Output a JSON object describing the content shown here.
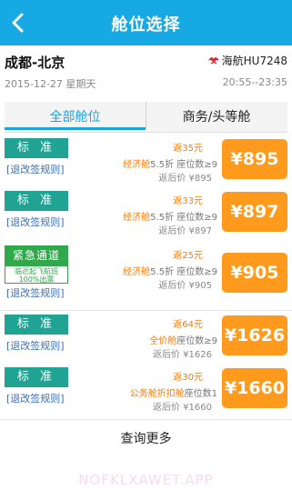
{
  "header": {
    "title": "舱位选择",
    "back_icon": "back-arrow-icon"
  },
  "route": {
    "name": "成都-北京",
    "airline": "海航HU7248",
    "airline_icon": "hainan-airlines-logo-icon",
    "date": "2015-12-27 星期天",
    "time": "20:55--23:35"
  },
  "tabs": [
    {
      "label": "全部舱位",
      "active": true
    },
    {
      "label": "商务/头等舱",
      "active": false
    }
  ],
  "fares": [
    {
      "badge": "标 准",
      "rules": "[退改签规则]",
      "discount": "返35元",
      "cabin": "经济舱",
      "cabin_info": "5.5折 座位数≥9",
      "after": "返后价 ¥895",
      "price": "¥895"
    },
    {
      "badge": "标 准",
      "rules": "[退改签规则]",
      "discount": "返33元",
      "cabin": "经济舱",
      "cabin_info": "5.5折 座位数≥9",
      "after": "返后价 ¥897",
      "price": "¥897"
    },
    {
      "badge": "紧急通道",
      "badge_sub": "临近起飞航班 100%出票",
      "rules": "[退改签规则]",
      "discount": "返25元",
      "cabin": "经济舱",
      "cabin_info": "5.5折 座位数≥9",
      "after": "返后价 ¥905",
      "price": "¥905"
    },
    {
      "badge": "标 准",
      "rules": "[退改签规则]",
      "discount": "返64元",
      "cabin": "全价舱",
      "cabin_info": "座位数≥9",
      "after": "返后价 ¥1626",
      "price": "¥1626"
    },
    {
      "badge": "标 准",
      "rules": "[退改签规则]",
      "discount": "返30元",
      "cabin": "公务舱折扣舱",
      "cabin_info": "座位数1",
      "after": "返后价 ¥1660",
      "price": "¥1660"
    }
  ],
  "more_label": "查询更多",
  "watermark": "NOFKLXAWET.APP",
  "colors": {
    "header": "#16a9e3",
    "price": "#ff9a1c",
    "badge": "#20a392",
    "urgent": "#31a84b",
    "accent": "#ff7a00"
  }
}
